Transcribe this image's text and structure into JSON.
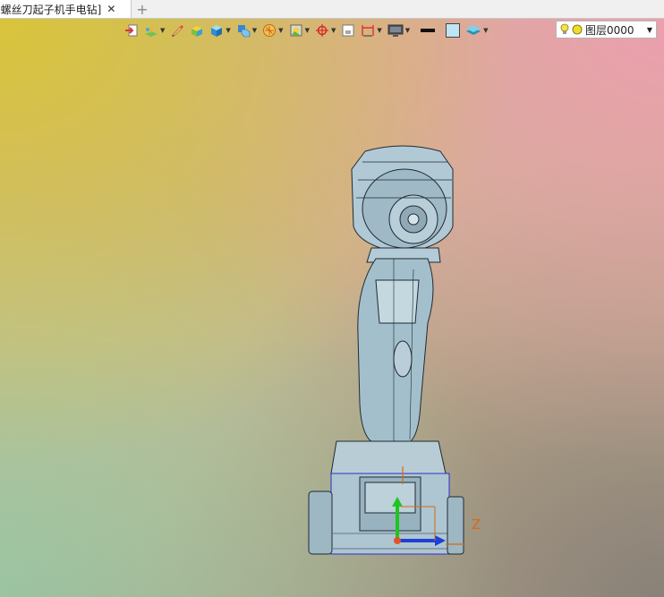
{
  "tab": {
    "title": "]螺丝刀起子机手电钻]",
    "close_glyph": "✕",
    "new_tab_glyph": "+"
  },
  "toolbar": {
    "items": [
      {
        "name": "exit-sketch-icon",
        "dropdown": false
      },
      {
        "name": "sketch-plane-icon",
        "dropdown": true
      },
      {
        "name": "pencil-icon",
        "dropdown": false
      },
      {
        "name": "extrude-icon",
        "dropdown": false
      },
      {
        "name": "solid-cube-icon",
        "dropdown": true
      },
      {
        "name": "view-cube-icon",
        "dropdown": true
      },
      {
        "name": "snap-filter-icon",
        "dropdown": true
      },
      {
        "name": "render-mode-icon",
        "dropdown": true
      },
      {
        "name": "target-icon",
        "dropdown": true
      },
      {
        "name": "zoom-fit-icon",
        "dropdown": false
      },
      {
        "name": "dimension-icon",
        "dropdown": true
      },
      {
        "name": "display-icon",
        "dropdown": true
      },
      {
        "name": "line-color-swatch",
        "dropdown": false
      },
      {
        "name": "face-color-swatch",
        "dropdown": false
      },
      {
        "name": "layer-stack-icon",
        "dropdown": true
      }
    ],
    "colors": {
      "line_swatch": "#111111",
      "face_swatch": "#bfe4f4"
    }
  },
  "layer": {
    "label": "图层0000",
    "dropdown_glyph": "▼",
    "bulb_color": "#f3e24a",
    "dot_color": "#f0dd2a"
  },
  "viewport": {
    "axis_label": "Z",
    "axis_colors": {
      "x": "#e0552a",
      "y": "#22c422",
      "z": "#1f3fd8",
      "label": "#d66a14"
    },
    "model_color": "#a7c2cf"
  }
}
